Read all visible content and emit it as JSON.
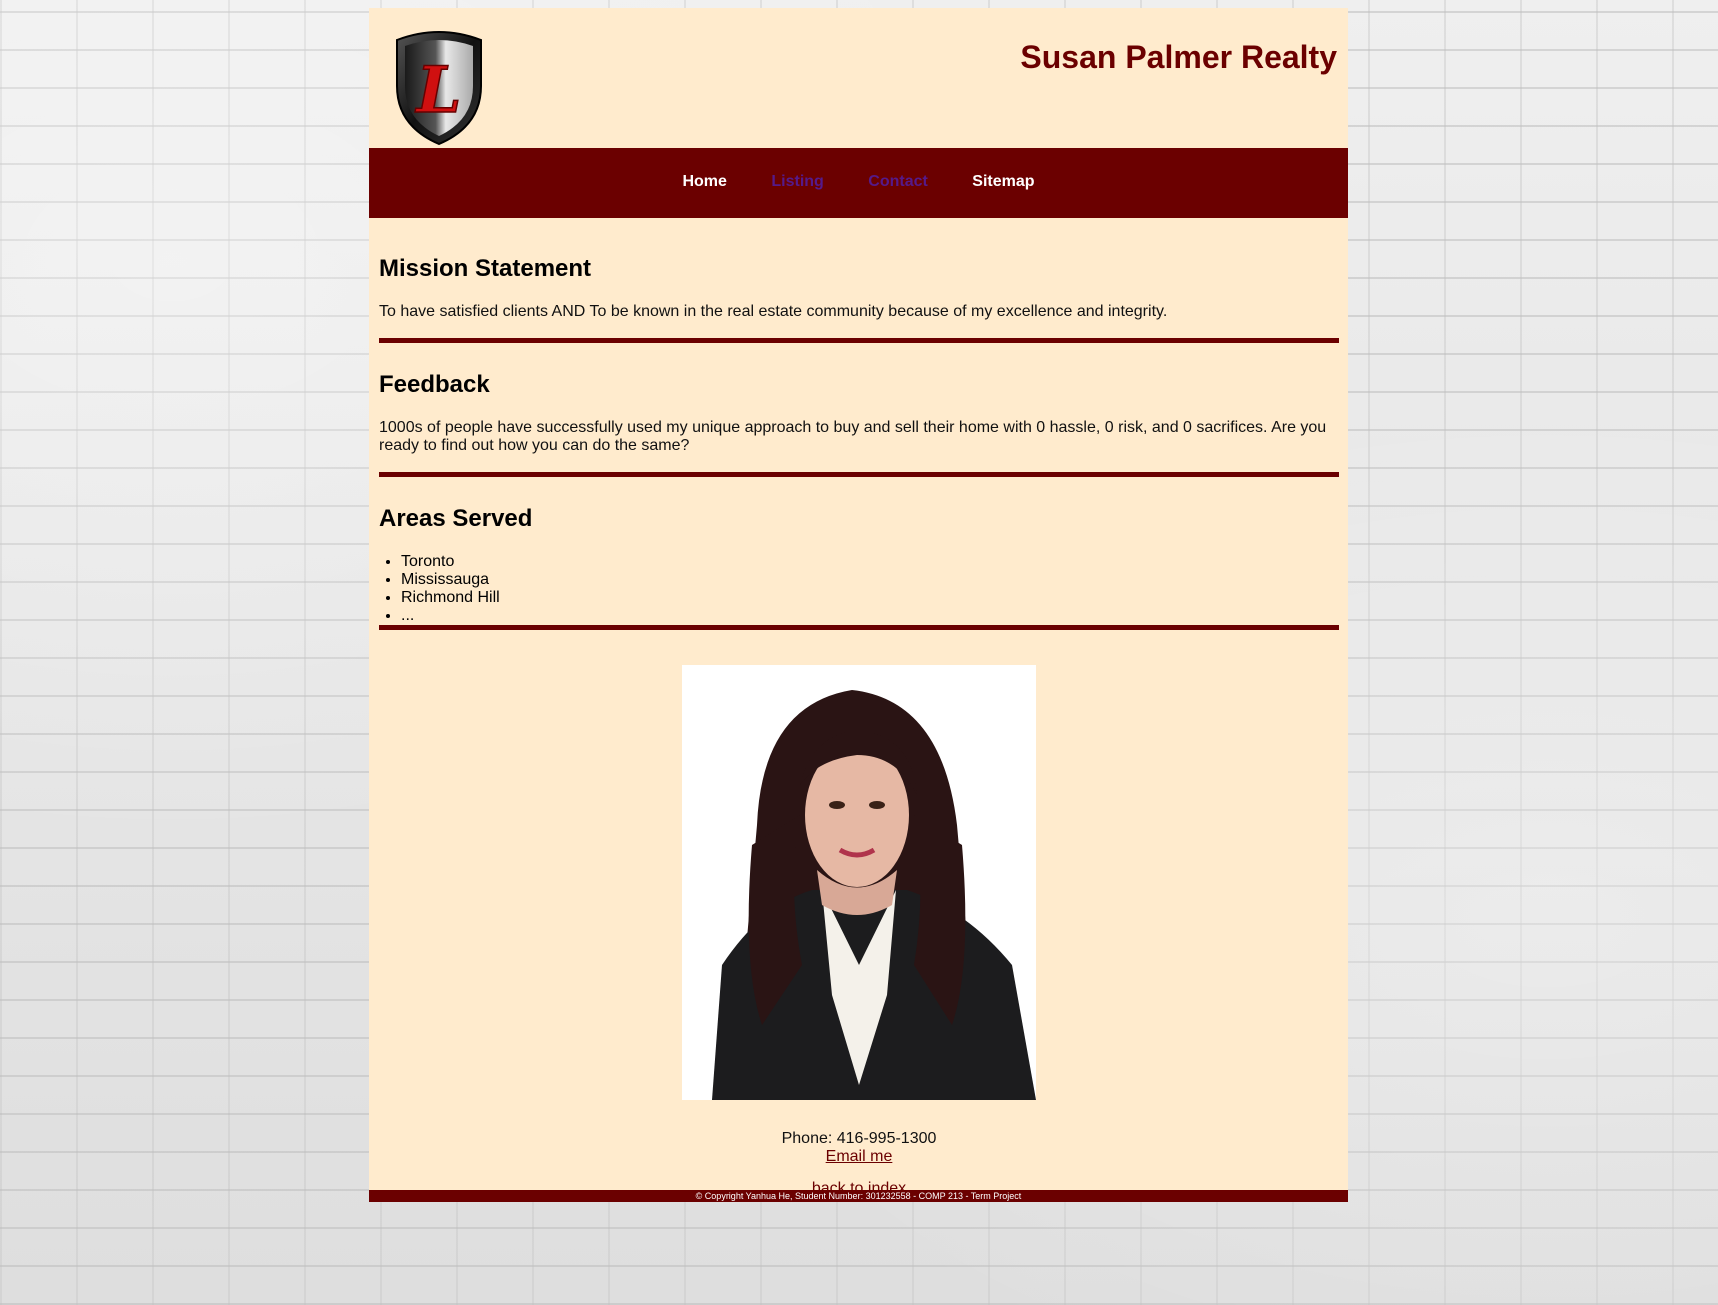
{
  "header": {
    "title": "Susan Palmer Realty",
    "logo_letter": "L"
  },
  "nav": {
    "home": "Home",
    "listing": "Listing",
    "contact": "Contact",
    "sitemap": "Sitemap"
  },
  "mission": {
    "heading": "Mission Statement",
    "text": "To have satisfied clients AND To be known in the real estate community because of my excellence and integrity."
  },
  "feedback": {
    "heading": "Feedback",
    "text": "1000s of people have successfully used my unique approach to buy and sell their home with 0 hassle, 0 risk, and 0 sacrifices. Are you ready to find out how you can do the same?"
  },
  "areas": {
    "heading": "Areas Served",
    "items": [
      "Toronto",
      "Mississauga",
      "Richmond Hill",
      "..."
    ]
  },
  "contact": {
    "phone": "Phone: 416-995-1300",
    "email_label": "Email me",
    "back_label": "back to index"
  },
  "footer": {
    "copyright": "© Copyright Yanhua He, Student Number: 301232558 - COMP 213 - Term Project"
  },
  "colors": {
    "brand": "#6b0000",
    "background": "#ffebcd",
    "visited_link": "#551a8b"
  }
}
